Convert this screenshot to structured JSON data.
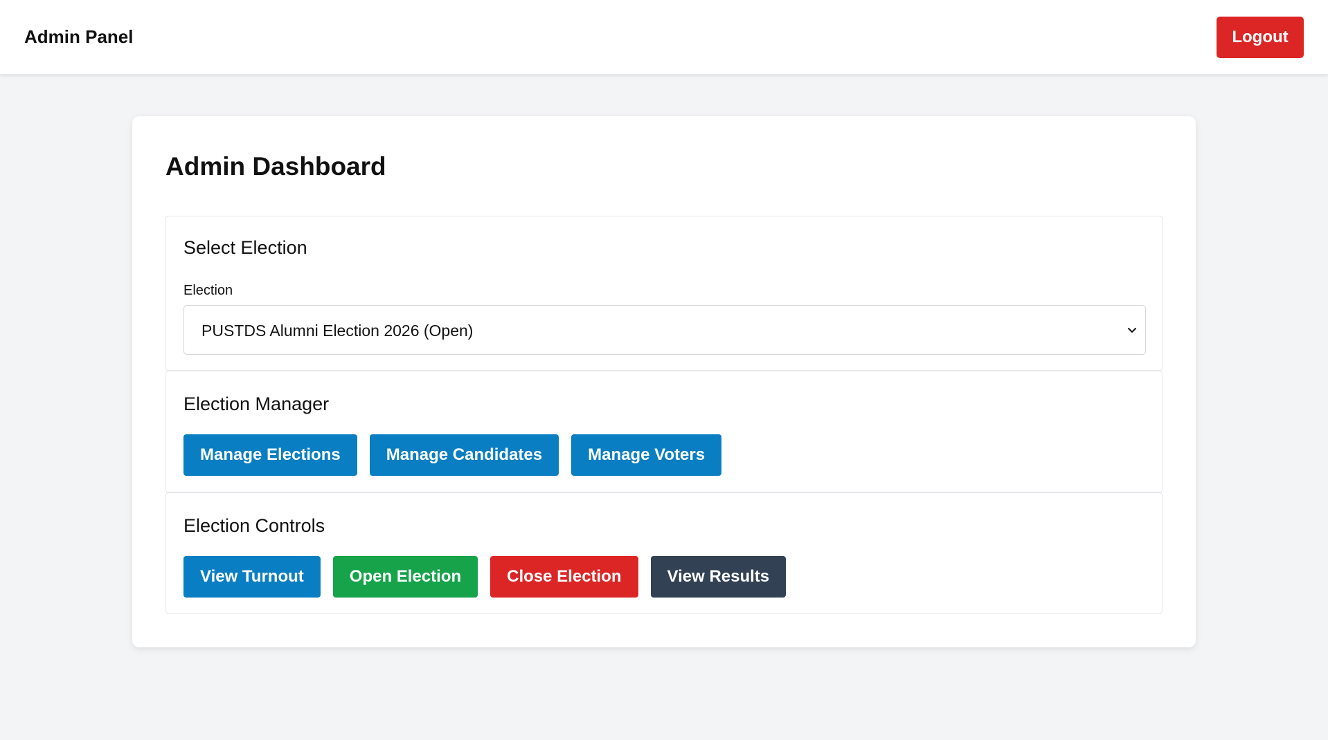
{
  "header": {
    "title": "Admin Panel",
    "logout_label": "Logout"
  },
  "dashboard": {
    "title": "Admin Dashboard"
  },
  "select_election": {
    "title": "Select Election",
    "field_label": "Election",
    "selected_value": "PUSTDS Alumni Election 2026 (Open)"
  },
  "election_manager": {
    "title": "Election Manager",
    "buttons": [
      {
        "label": "Manage Elections",
        "color": "#0a7ec2"
      },
      {
        "label": "Manage Candidates",
        "color": "#0a7ec2"
      },
      {
        "label": "Manage Voters",
        "color": "#0a7ec2"
      }
    ]
  },
  "election_controls": {
    "title": "Election Controls",
    "buttons": [
      {
        "label": "View Turnout",
        "color": "#0a7ec2"
      },
      {
        "label": "Open Election",
        "color": "#16a34a"
      },
      {
        "label": "Close Election",
        "color": "#dc2626"
      },
      {
        "label": "View Results",
        "color": "#334155"
      }
    ]
  },
  "icons": {
    "select_arrow": "chevron-down-icon"
  }
}
